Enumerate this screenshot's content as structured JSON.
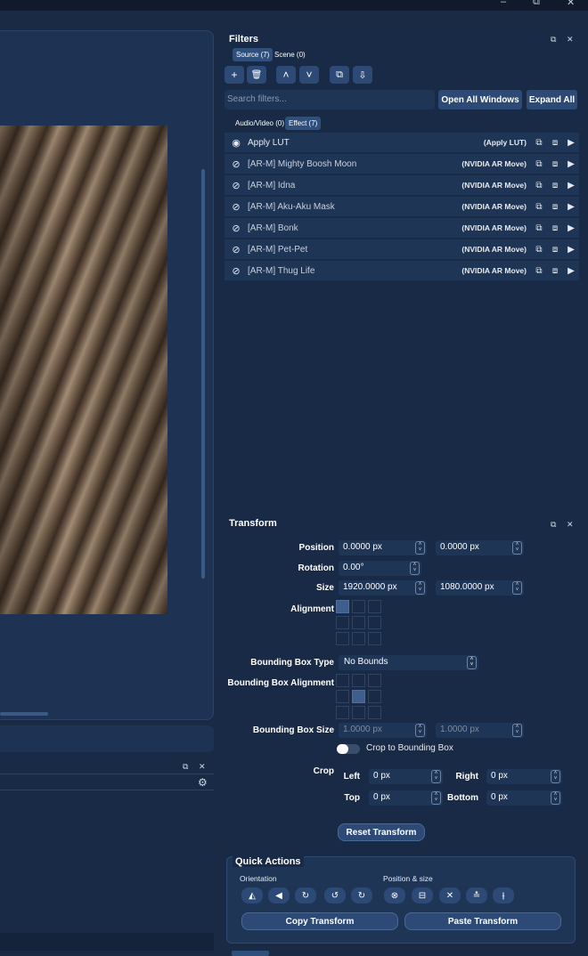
{
  "window": {
    "minimize": "–",
    "restore": "⧉",
    "close": "✕"
  },
  "filters": {
    "title": "Filters",
    "float_icon": "⧉",
    "close_icon": "✕",
    "target_tabs": [
      "Source (7)",
      "Scene (0)"
    ],
    "toolbar": {
      "add": "+",
      "remove": "🗑",
      "up": "˄",
      "down": "˅",
      "copy": "⧉",
      "paste": "⇩"
    },
    "search_placeholder": "Search filters...",
    "open_all_windows": "Open All Windows",
    "expand_all": "Expand All",
    "type_tabs": [
      "Audio/Video (0)",
      "Effect (7)"
    ],
    "rows": [
      {
        "name": "Apply LUT",
        "kind": "(Apply LUT)",
        "visible": true
      },
      {
        "name": "[AR-M] Mighty Boosh Moon",
        "kind": "(NVIDIA AR Move)",
        "visible": false
      },
      {
        "name": "[AR-M] Idna",
        "kind": "(NVIDIA AR Move)",
        "visible": false
      },
      {
        "name": "[AR-M] Aku-Aku Mask",
        "kind": "(NVIDIA AR Move)",
        "visible": false
      },
      {
        "name": "[AR-M] Bonk",
        "kind": "(NVIDIA AR Move)",
        "visible": false
      },
      {
        "name": "[AR-M] Pet-Pet",
        "kind": "(NVIDIA AR Move)",
        "visible": false
      },
      {
        "name": "[AR-M] Thug Life",
        "kind": "(NVIDIA AR Move)",
        "visible": false
      }
    ]
  },
  "transform": {
    "title": "Transform",
    "position_label": "Position",
    "position_x": "0.0000 px",
    "position_y": "0.0000 px",
    "rotation_label": "Rotation",
    "rotation": "0.00°",
    "size_label": "Size",
    "size_w": "1920.0000 px",
    "size_h": "1080.0000 px",
    "alignment_label": "Alignment",
    "bbox_type_label": "Bounding Box Type",
    "bbox_type": "No Bounds",
    "bbox_align_label": "Bounding Box Alignment",
    "bbox_size_label": "Bounding Box Size",
    "bbox_w": "1.0000 px",
    "bbox_h": "1.0000 px",
    "crop_to_bbox_label": "Crop to Bounding Box",
    "crop_label": "Crop",
    "crop_left_label": "Left",
    "crop_left": "0 px",
    "crop_right_label": "Right",
    "crop_right": "0 px",
    "crop_top_label": "Top",
    "crop_top": "0 px",
    "crop_bottom_label": "Bottom",
    "crop_bottom": "0 px",
    "reset": "Reset Transform"
  },
  "quick_actions": {
    "title": "Quick Actions",
    "orientation_label": "Orientation",
    "position_size_label": "Position & size",
    "copy_transform": "Copy Transform",
    "paste_transform": "Paste Transform"
  },
  "left_dock": {
    "float_icon": "⧉",
    "close_icon": "✕",
    "settings_icon": "⚙"
  },
  "colors": {
    "accent": "#2c4a75",
    "panel": "#182a45",
    "background": "#1a2a44"
  }
}
